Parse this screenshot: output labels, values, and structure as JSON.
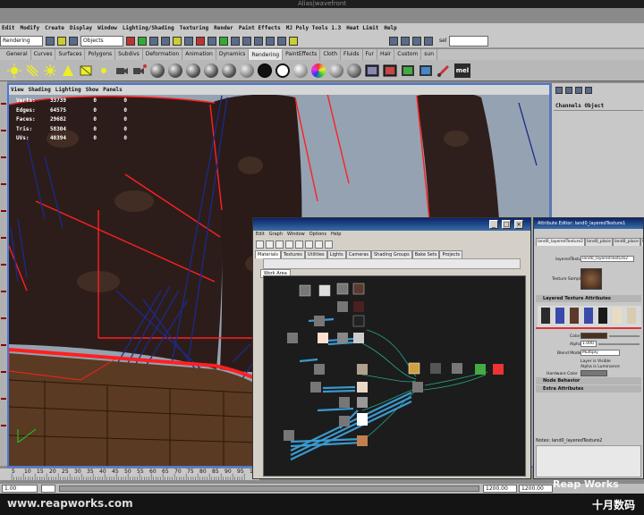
{
  "window": {
    "title": "Alias|wavefront"
  },
  "menubar": [
    "Edit",
    "Modify",
    "Create",
    "Display",
    "Window",
    "Lighting/Shading",
    "Texturing",
    "Render",
    "Paint Effects",
    "MJ Poly Tools 1.3",
    "Heat Limit",
    "Help"
  ],
  "status_line": {
    "mode": "Rendering",
    "selection_mask": "Objects",
    "sel_label": "sel"
  },
  "shelf_tabs": [
    {
      "label": "General"
    },
    {
      "label": "Curves"
    },
    {
      "label": "Surfaces"
    },
    {
      "label": "Polygons"
    },
    {
      "label": "Subdivs"
    },
    {
      "label": "Deformation"
    },
    {
      "label": "Animation"
    },
    {
      "label": "Dynamics"
    },
    {
      "label": "Rendering",
      "active": true
    },
    {
      "label": "PaintEffects"
    },
    {
      "label": "Cloth"
    },
    {
      "label": "Fluids"
    },
    {
      "label": "Fur"
    },
    {
      "label": "Hair"
    },
    {
      "label": "Custom"
    },
    {
      "label": "sun"
    }
  ],
  "shelf": {
    "mel_label": "mel"
  },
  "viewport": {
    "menu": [
      "View",
      "Shading",
      "Lighting",
      "Show",
      "Panels"
    ],
    "poly_count": [
      {
        "label": "Verts:",
        "value": "33739",
        "sel": "0",
        "comp": "0"
      },
      {
        "label": "Edges:",
        "value": "64575",
        "sel": "0",
        "comp": "0"
      },
      {
        "label": "Faces:",
        "value": "29682",
        "sel": "0",
        "comp": "0"
      },
      {
        "label": "Tris:",
        "value": "58304",
        "sel": "0",
        "comp": "0"
      },
      {
        "label": "UVs:",
        "value": "40394",
        "sel": "0",
        "comp": "0"
      }
    ]
  },
  "channel_box": {
    "tabs": "Channels  Object"
  },
  "timeline": {
    "ticks": [
      "5",
      "10",
      "15",
      "20",
      "25",
      "30",
      "35",
      "40",
      "45",
      "50",
      "55",
      "60",
      "65",
      "70",
      "75",
      "80",
      "85",
      "90",
      "95",
      "100"
    ],
    "range_start": "1.00",
    "range_end_a": "1200.00",
    "range_end_b": "1200.00"
  },
  "hypershade": {
    "menu": [
      "Edit",
      "Graph",
      "Window",
      "Options",
      "Help"
    ],
    "tabs": [
      {
        "label": "Materials",
        "active": true
      },
      {
        "label": "Textures"
      },
      {
        "label": "Utilities"
      },
      {
        "label": "Lights"
      },
      {
        "label": "Cameras"
      },
      {
        "label": "Shading Groups"
      },
      {
        "label": "Bake Sets"
      },
      {
        "label": "Projects"
      }
    ],
    "work_area_tab": "Work Area"
  },
  "attribute_editor": {
    "title": "Attribute Editor: land0_layeredTexture1",
    "tabs": [
      {
        "label": "land0_layeredTexture2",
        "active": true
      },
      {
        "label": "land0_place"
      },
      {
        "label": "land0_place"
      },
      {
        "label": "land0_c"
      }
    ],
    "type_label": "layeredTexture",
    "node_name": "land0_layeredTexture2",
    "sample_label": "Texture Sample",
    "layered_section": "Layered Texture Attributes",
    "color_label": "Color",
    "alpha_label": "Alpha",
    "alpha_value": "1.000",
    "blend_label": "Blend Mode",
    "blend_value": "Multiply",
    "layer_visible": "Layer is Visible",
    "alpha_luminance": "Alpha is Luminance",
    "hardware_color": "Hardware Color",
    "node_behavior": "Node Behavior",
    "extra_attributes": "Extra Attributes",
    "notes": "Notes:  land0_layeredTexture2"
  },
  "watermarks": {
    "site": "www.reapworks.com",
    "brand": "Reap Works",
    "logo": "十月数码"
  },
  "colors": {
    "accent": "#4a78d8",
    "selection": "#ff2020",
    "wire": "#1a2a8a"
  }
}
